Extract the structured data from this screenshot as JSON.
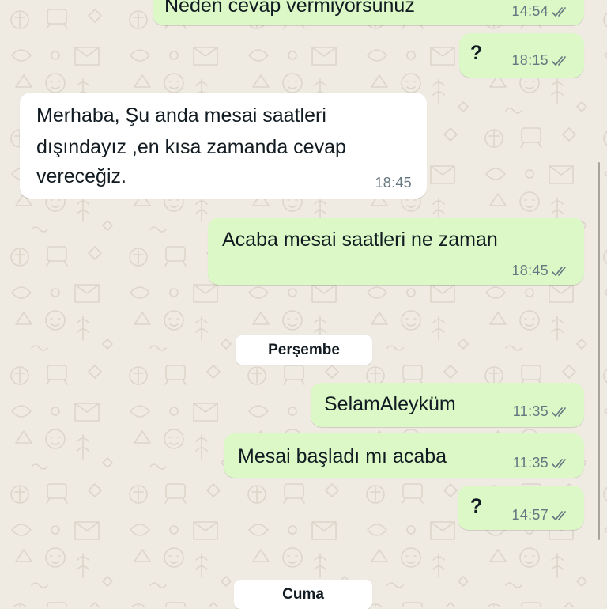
{
  "chat": {
    "messages": [
      {
        "id": "m1",
        "direction": "outgoing",
        "text": "Neden cevap vermiyorsunuz",
        "time": "14:54",
        "status_icon": "double-check-icon"
      },
      {
        "id": "m2",
        "direction": "outgoing",
        "text": "?",
        "time": "18:15",
        "status_icon": "double-check-icon"
      },
      {
        "id": "m3",
        "direction": "incoming",
        "lines": [
          "Merhaba,  Şu anda mesai saatleri",
          "dışındayız ,en kısa zamanda cevap",
          "vereceğiz."
        ],
        "time": "18:45"
      },
      {
        "id": "m4",
        "direction": "outgoing",
        "text": "Acaba mesai saatleri ne zaman",
        "time": "18:45",
        "status_icon": "double-check-icon"
      },
      {
        "id": "m5",
        "direction": "outgoing",
        "text": "SelamAleyküm",
        "time": "11:35",
        "status_icon": "double-check-icon"
      },
      {
        "id": "m6",
        "direction": "outgoing",
        "text": "Mesai başladı mı acaba",
        "time": "11:35",
        "status_icon": "double-check-icon"
      },
      {
        "id": "m7",
        "direction": "outgoing",
        "text": "?",
        "time": "14:57",
        "status_icon": "double-check-icon"
      }
    ],
    "date_separators": [
      {
        "label": "Perşembe"
      },
      {
        "label": "Cuma"
      }
    ]
  },
  "colors": {
    "wallpaper": "#efeae2",
    "outgoing_bubble": "#dbf8c6",
    "incoming_bubble": "#ffffff",
    "meta_text": "#667781",
    "message_text": "#111b21"
  }
}
